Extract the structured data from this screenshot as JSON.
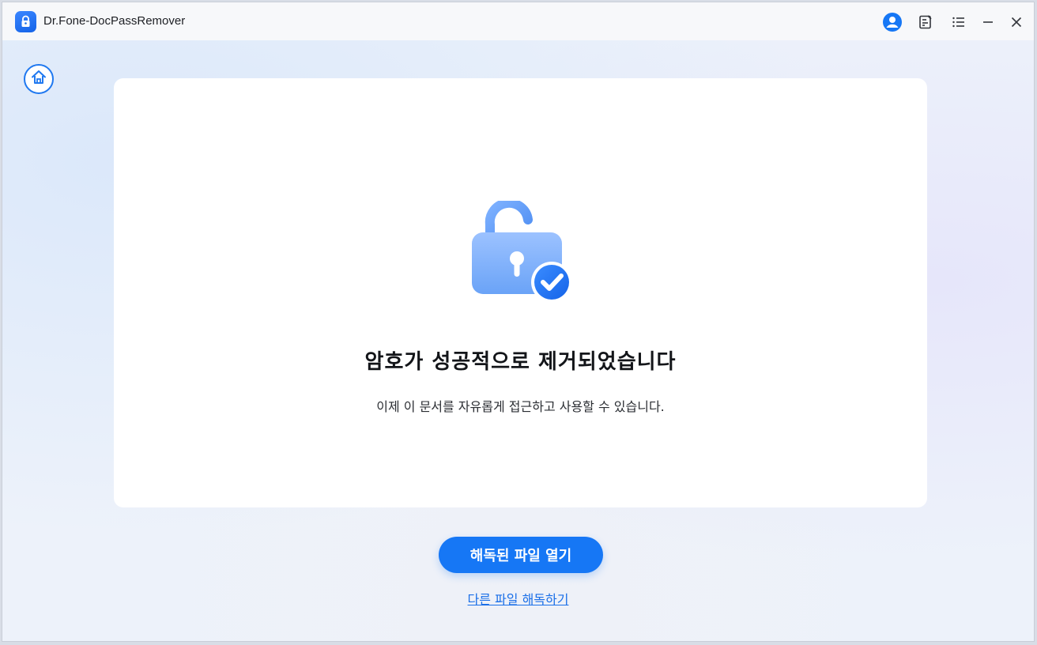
{
  "window": {
    "title": "Dr.Fone-DocPassRemover"
  },
  "titlebar": {
    "icons": [
      "lock-app-icon",
      "account-icon",
      "feedback-icon",
      "menu-icon",
      "minimize-icon",
      "close-icon"
    ]
  },
  "nav": {
    "home_icon": "home-icon"
  },
  "result": {
    "illustration": "unlocked-lock-with-check-icon",
    "headline": "암호가 성공적으로 제거되었습니다",
    "subtext": "이제 이 문서를 자유롭게 접근하고 사용할 수 있습니다."
  },
  "actions": {
    "open_decrypted_label": "해독된 파일 열기",
    "decrypt_another_label": "다른 파일 해독하기"
  },
  "colors": {
    "accent": "#1677f5",
    "success_check": "#1f78f0"
  }
}
